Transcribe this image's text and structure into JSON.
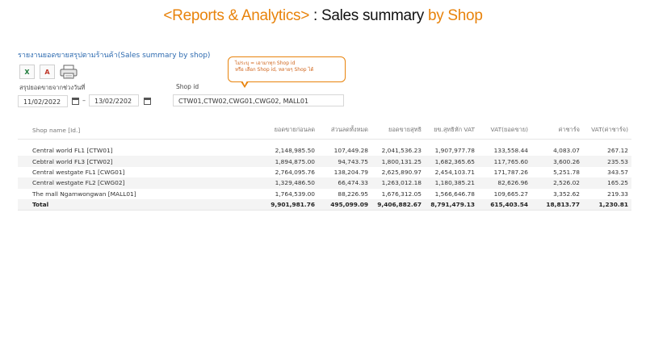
{
  "title": {
    "part1": "<Reports & Analytics>",
    "part2": " : Sales summary ",
    "part3": "by Shop",
    "color_accent": "#e8830c"
  },
  "report_heading": "รายงานยอดขายสรุปตามร้านค้า(Sales summary by shop)",
  "toolbar": {
    "excel_icon": "excel-icon",
    "pdf_icon": "pdf-icon",
    "print_icon": "printer-icon",
    "excel_label": "X",
    "pdf_label": "A"
  },
  "filters": {
    "date_label": "สรุปยอดขายจากช่วงวันที่",
    "date_from": "11/02/2022",
    "date_to": "13/02/2202",
    "separator": "–",
    "shop_label": "Shop id",
    "shop_value": "CTW01,CTW02,CWG01,CWG02, MALL01"
  },
  "callout": {
    "line1": "ไม่ระบุ = เอามาทุก Shop id",
    "line2": "หรือ เลือก Shop id, หลายๆ Shop ได้"
  },
  "table": {
    "columns": [
      "Shop name [Id.]",
      "ยอดขายก่อนลด",
      "ส่วนลดทั้งหมด",
      "ยอดขายสุทธิ",
      "ยข.สุทธิหัก VAT",
      "VAT(ยอดขาย)",
      "ค่าชาร์จ",
      "VAT(ค่าชาร์จ)"
    ],
    "rows": [
      [
        "Central world FL1 [CTW01]",
        "2,148,985.50",
        "107,449.28",
        "2,041,536.23",
        "1,907,977.78",
        "133,558.44",
        "4,083.07",
        "267.12"
      ],
      [
        "Cebtral world FL3 [CTW02]",
        "1,894,875.00",
        "94,743.75",
        "1,800,131.25",
        "1,682,365.65",
        "117,765.60",
        "3,600.26",
        "235.53"
      ],
      [
        "Central westgate FL1 [CWG01]",
        "2,764,095.76",
        "138,204.79",
        "2,625,890.97",
        "2,454,103.71",
        "171,787.26",
        "5,251.78",
        "343.57"
      ],
      [
        "Central westgate FL2 [CWG02]",
        "1,329,486.50",
        "66,474.33",
        "1,263,012.18",
        "1,180,385.21",
        "82,626.96",
        "2,526.02",
        "165.25"
      ],
      [
        "The mall Ngamwongwan [MALL01]",
        "1,764,539.00",
        "88,226.95",
        "1,676,312.05",
        "1,566,646.78",
        "109,665.27",
        "3,352.62",
        "219.33"
      ]
    ],
    "total": [
      "Total",
      "9,901,981.76",
      "495,099.09",
      "9,406,882.67",
      "8,791,479.13",
      "615,403.54",
      "18,813.77",
      "1,230.81"
    ]
  }
}
